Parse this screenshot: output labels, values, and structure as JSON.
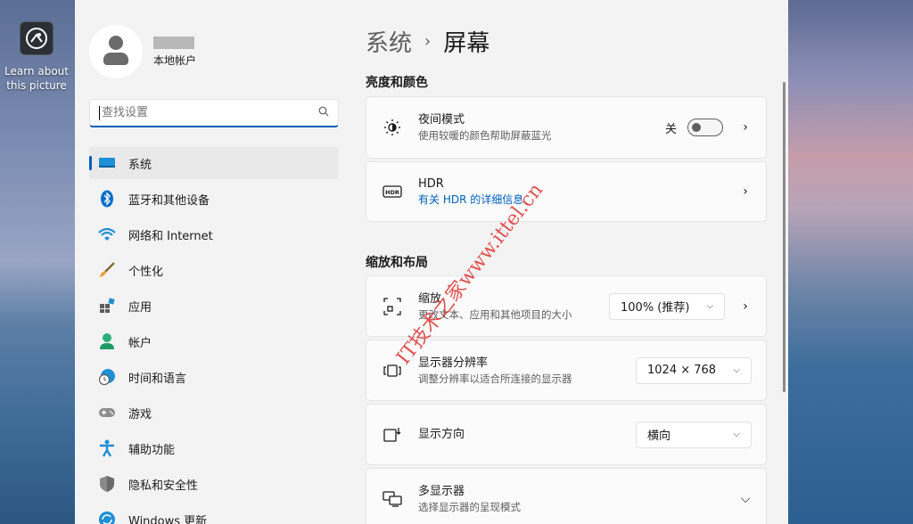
{
  "desktop": {
    "icon_label": "Learn about this picture"
  },
  "sidebar": {
    "account_label": "本地帐户",
    "search_placeholder": "查找设置",
    "items": [
      {
        "label": "系统",
        "icon": "monitor-icon",
        "active": true
      },
      {
        "label": "蓝牙和其他设备",
        "icon": "bluetooth-icon"
      },
      {
        "label": "网络和 Internet",
        "icon": "wifi-icon"
      },
      {
        "label": "个性化",
        "icon": "brush-icon"
      },
      {
        "label": "应用",
        "icon": "apps-icon"
      },
      {
        "label": "帐户",
        "icon": "person-icon"
      },
      {
        "label": "时间和语言",
        "icon": "globe-clock-icon"
      },
      {
        "label": "游戏",
        "icon": "gamepad-icon"
      },
      {
        "label": "辅助功能",
        "icon": "accessibility-icon"
      },
      {
        "label": "隐私和安全性",
        "icon": "shield-icon"
      },
      {
        "label": "Windows 更新",
        "icon": "update-icon"
      }
    ]
  },
  "main": {
    "breadcrumb_parent": "系统",
    "breadcrumb_current": "屏幕",
    "section_brightness": "亮度和颜色",
    "night_light": {
      "title": "夜间模式",
      "subtitle": "使用较暖的颜色帮助屏蔽蓝光",
      "toggle_state": "关"
    },
    "hdr": {
      "title": "HDR",
      "link": "有关 HDR 的详细信息"
    },
    "section_scale": "缩放和布局",
    "scale": {
      "title": "缩放",
      "subtitle": "更改文本、应用和其他项目的大小",
      "value": "100% (推荐)"
    },
    "resolution": {
      "title": "显示器分辨率",
      "subtitle": "调整分辨率以适合所连接的显示器",
      "value": "1024 × 768"
    },
    "orientation": {
      "title": "显示方向",
      "value": "横向"
    },
    "multi_display": {
      "title": "多显示器",
      "subtitle": "选择显示器的呈现模式"
    }
  },
  "watermark": "IT技术之家www.ittel.cn",
  "colors": {
    "accent": "#005fb8",
    "window_bg": "#f3f3f3",
    "card_bg": "#fbfbfb"
  }
}
